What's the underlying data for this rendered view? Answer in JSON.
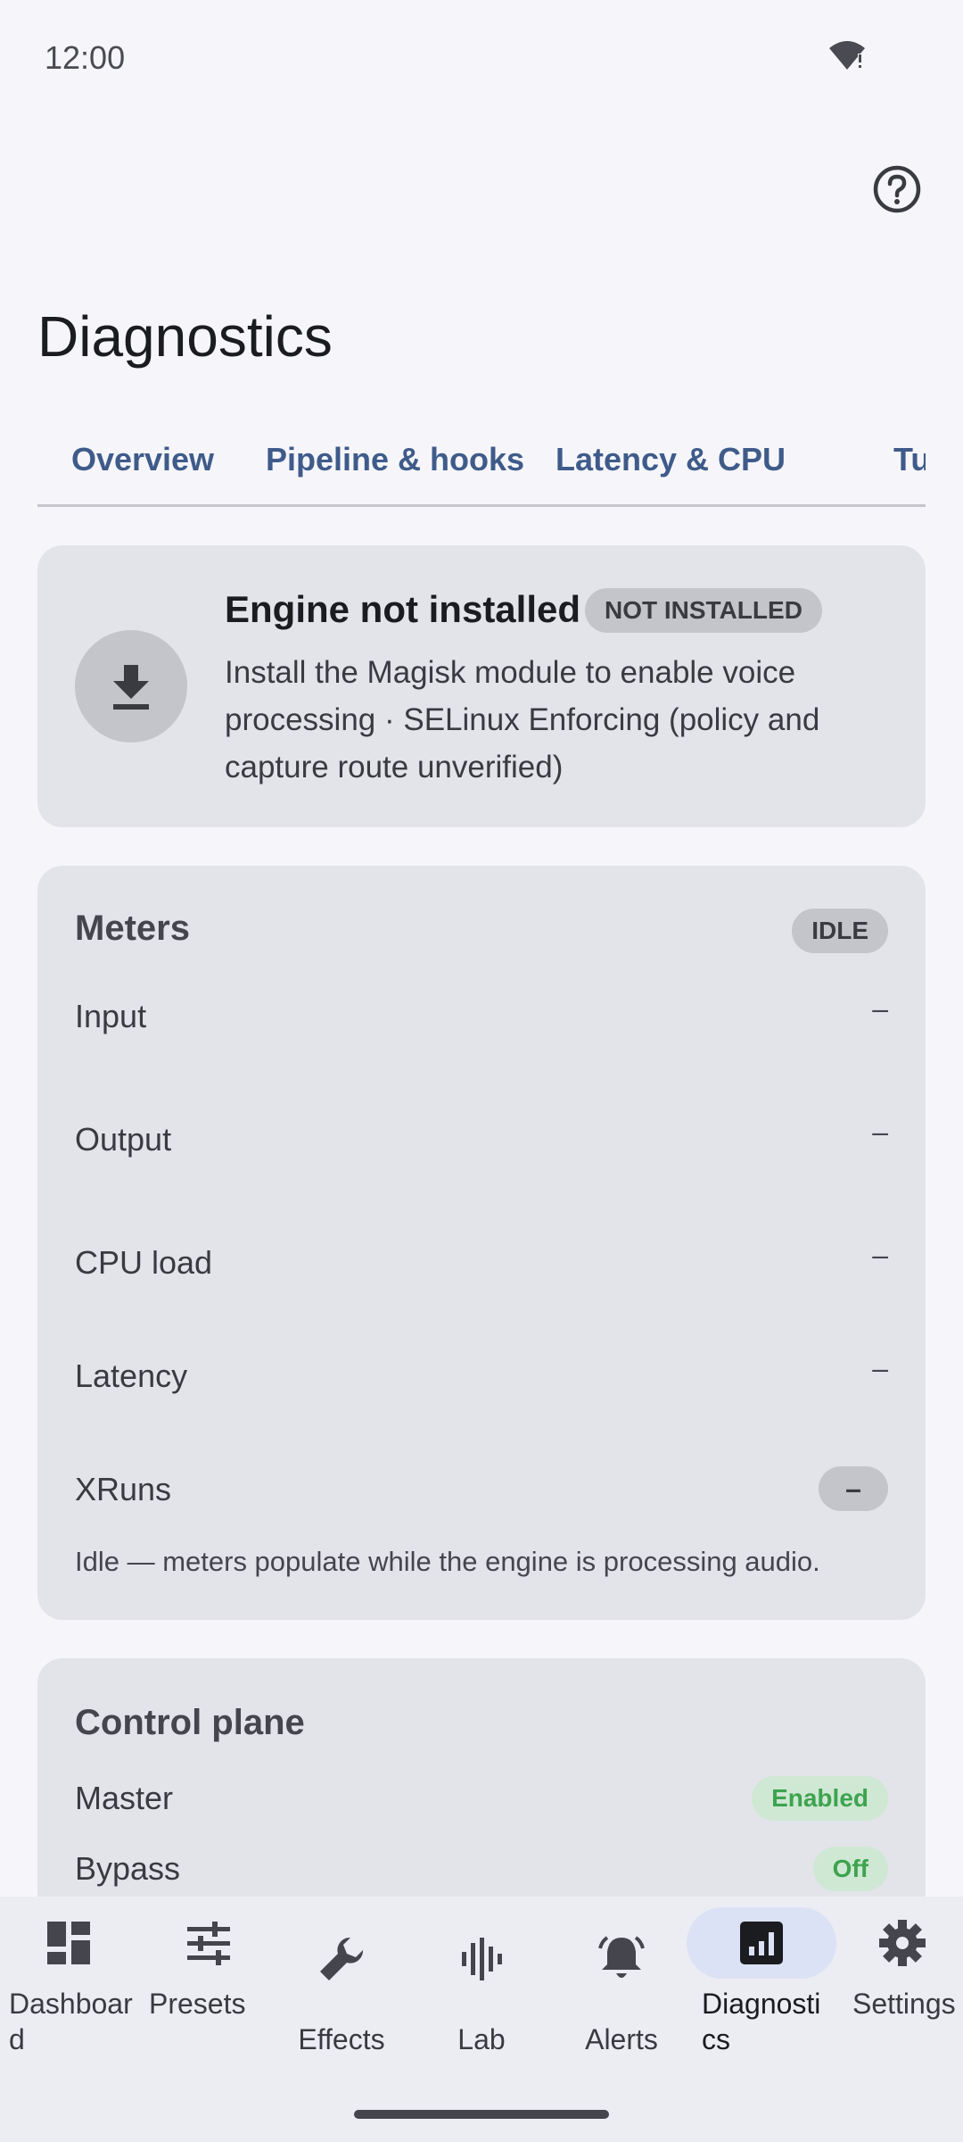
{
  "status_bar": {
    "time": "12:00"
  },
  "page": {
    "title": "Diagnostics"
  },
  "tabs": [
    {
      "label": "Overview",
      "active": true
    },
    {
      "label": "Pipeline & hooks",
      "active": false
    },
    {
      "label": "Latency & CPU",
      "active": false
    },
    {
      "label": "Tu",
      "active": false
    }
  ],
  "engine": {
    "title": "Engine not installed",
    "badge": "NOT INSTALLED",
    "description": "Install the Magisk module to enable voice processing · SELinux Enforcing (policy and capture route unverified)",
    "icon": "download-icon"
  },
  "meters": {
    "title": "Meters",
    "badge": "IDLE",
    "rows": [
      {
        "label": "Input",
        "value": "–"
      },
      {
        "label": "Output",
        "value": "–"
      },
      {
        "label": "CPU load",
        "value": "–"
      },
      {
        "label": "Latency",
        "value": "–"
      },
      {
        "label": "XRuns",
        "value": "–"
      }
    ],
    "note": "Idle — meters populate while the engine is processing audio."
  },
  "control_plane": {
    "title": "Control plane",
    "rows": [
      {
        "label": "Master",
        "value": "Enabled"
      },
      {
        "label": "Bypass",
        "value": "Off"
      }
    ]
  },
  "bottom_nav": [
    {
      "label": "Dashboard",
      "icon": "dashboard-icon"
    },
    {
      "label": "Presets",
      "icon": "tune-icon"
    },
    {
      "label": "Effects",
      "icon": "wrench-icon"
    },
    {
      "label": "Lab",
      "icon": "waveform-icon"
    },
    {
      "label": "Alerts",
      "icon": "bell-icon"
    },
    {
      "label": "Diagnostics",
      "icon": "chart-icon",
      "active": true
    },
    {
      "label": "Settings",
      "icon": "gear-icon"
    }
  ],
  "colors": {
    "accent": "#3f5b8a",
    "card": "#e3e3ea",
    "success": "#3ea34f",
    "nav_active": "#dce2f5"
  }
}
